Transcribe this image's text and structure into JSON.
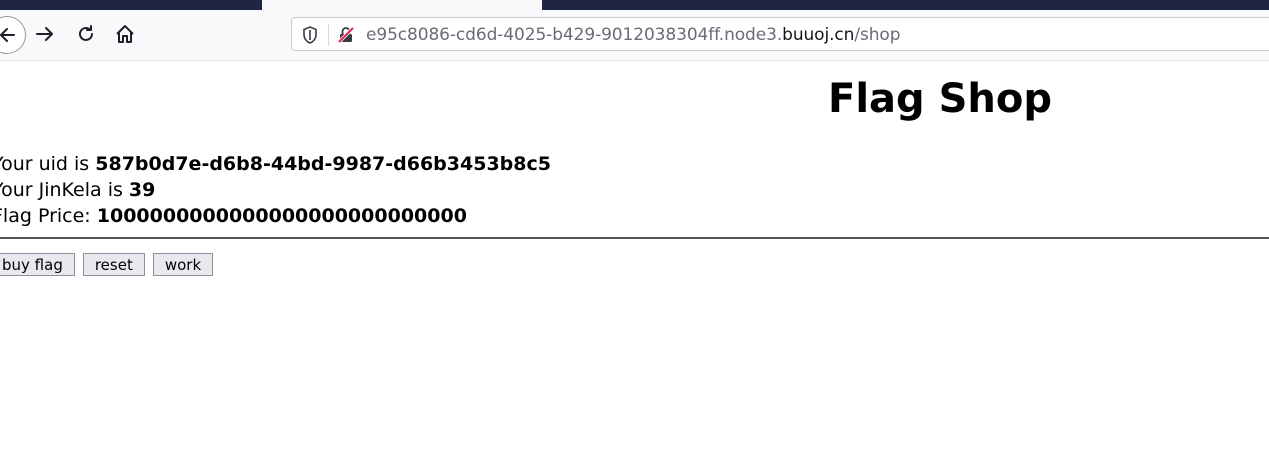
{
  "browser": {
    "url_prefix": "e95c8086-cd6d-4025-b429-9012038304ff.node3.",
    "url_domain": "buuoj.cn",
    "url_path": "/shop",
    "icons": {
      "back": "back-arrow-icon",
      "forward": "forward-arrow-icon",
      "reload": "reload-icon",
      "home": "home-icon",
      "shield": "tracking-shield-icon",
      "insecure_lock": "insecure-lock-icon"
    }
  },
  "page": {
    "title": "Flag Shop",
    "uid_label": "Your uid is ",
    "uid_value": "587b0d7e-d6b8-44bd-9987-d66b3453b8c5",
    "jinkela_label": "Your JinKela is ",
    "jinkela_value": "39",
    "price_label": "Flag Price: ",
    "price_value": "1000000000000000000000000000",
    "buttons": {
      "buy_flag": "buy flag",
      "reset": "reset",
      "work": "work"
    }
  },
  "colors": {
    "tabstrip": "#1f2543",
    "toolbar": "#f9f9fb",
    "insecure_accent": "#e22850"
  }
}
